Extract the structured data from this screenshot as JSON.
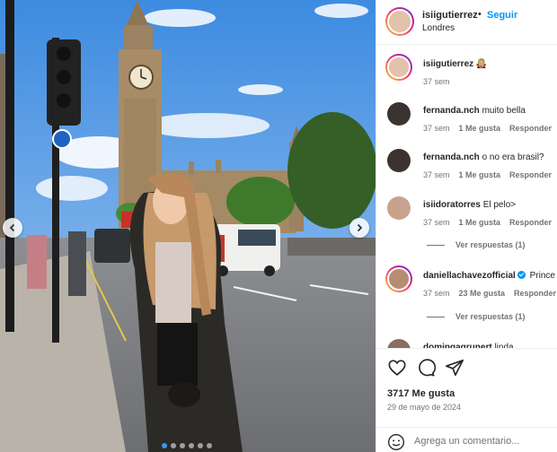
{
  "post": {
    "image_alt": "",
    "carousel": {
      "dots_total": 6,
      "active_index": 0
    }
  },
  "header": {
    "username": "isiigutierrez",
    "separator": "•",
    "follow_label": "Seguir",
    "location": "Londres"
  },
  "comments": [
    {
      "username": "isiigutierrez",
      "text": "🧛🏼‍♀️",
      "time": "37 sem",
      "likes": "",
      "reply": "",
      "story_ring": true,
      "avatar_color": "#e2c2a8"
    },
    {
      "username": "fernanda.nch",
      "text": "muito bella",
      "time": "37 sem",
      "likes": "1 Me gusta",
      "reply": "Responder",
      "story_ring": false,
      "avatar_color": "#3a3330"
    },
    {
      "username": "fernanda.nch",
      "text": "o no era brasil?",
      "time": "37 sem",
      "likes": "1 Me gusta",
      "reply": "Responder",
      "story_ring": false,
      "avatar_color": "#3a3330"
    },
    {
      "username": "isiidoratorres",
      "text": "El pelo>",
      "time": "37 sem",
      "likes": "1 Me gusta",
      "reply": "Responder",
      "story_ring": false,
      "avatar_color": "#c9a28e"
    },
    {
      "username": "daniellachavezofficial",
      "text": "Prince",
      "time": "37 sem",
      "likes": "23 Me gusta",
      "reply": "Responder",
      "story_ring": true,
      "verified": true,
      "avatar_color": "#b58d72"
    },
    {
      "username": "domingagrunert",
      "text": "linda",
      "time": "",
      "likes": "",
      "reply": "",
      "story_ring": false,
      "avatar_color": "#8a6f5e"
    }
  ],
  "replies": [
    {
      "label": "Ver respuestas (1)"
    },
    {
      "label": "Ver respuestas (1)"
    }
  ],
  "stats": {
    "likes": "3717 Me gusta",
    "date": "29 de mayo de 2024"
  },
  "composer": {
    "placeholder": "Agrega un comentario..."
  },
  "colors": {
    "accent": "#0095f6",
    "muted": "#737373",
    "text": "#262626"
  },
  "icons": [
    "chevron-left-icon",
    "chevron-right-icon",
    "heart-icon",
    "comment-icon",
    "share-icon",
    "emoji-icon",
    "verified-icon"
  ]
}
